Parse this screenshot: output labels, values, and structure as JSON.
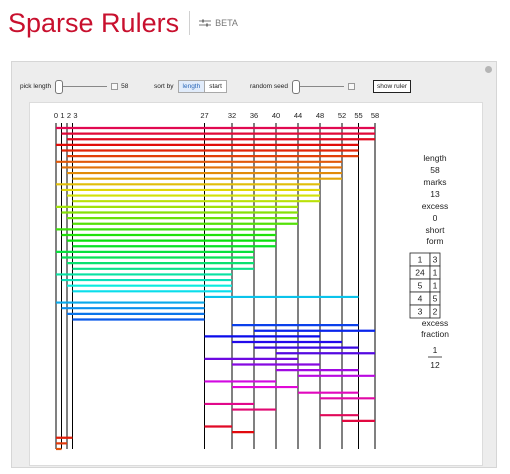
{
  "app": {
    "title": "Sparse Rulers",
    "badge": "BETA"
  },
  "controls": {
    "pick_length": {
      "label": "pick length",
      "value": "58"
    },
    "sort_by": {
      "label": "sort by",
      "options": [
        "length",
        "start"
      ],
      "selected": "length"
    },
    "random_seed": {
      "label": "random seed"
    },
    "show_ruler": {
      "label": "show ruler"
    }
  },
  "ruler": {
    "marks": [
      0,
      1,
      2,
      3,
      27,
      32,
      36,
      40,
      44,
      48,
      52,
      55,
      58
    ],
    "mark_labels": [
      "0",
      "1",
      "2",
      "3",
      "27",
      "32",
      "36",
      "40",
      "44",
      "48",
      "52",
      "55",
      "58"
    ],
    "colors": {
      "lines": "#000000",
      "spectrum_start": "#e01010",
      "spectrum_end": "#e86800"
    }
  },
  "stats": {
    "length_label": "length",
    "length_value": "58",
    "marks_label": "marks",
    "marks_value": "13",
    "excess_label": "excess",
    "excess_value": "0",
    "short_form_label": "short",
    "short_form_label2": "form",
    "short_form": [
      [
        "1",
        "3"
      ],
      [
        "24",
        "1"
      ],
      [
        "5",
        "1"
      ],
      [
        "4",
        "5"
      ],
      [
        "3",
        "2"
      ]
    ],
    "excess_fraction_label": "excess",
    "excess_fraction_label2": "fraction",
    "fraction_numerator": "1",
    "fraction_denominator": "12"
  }
}
